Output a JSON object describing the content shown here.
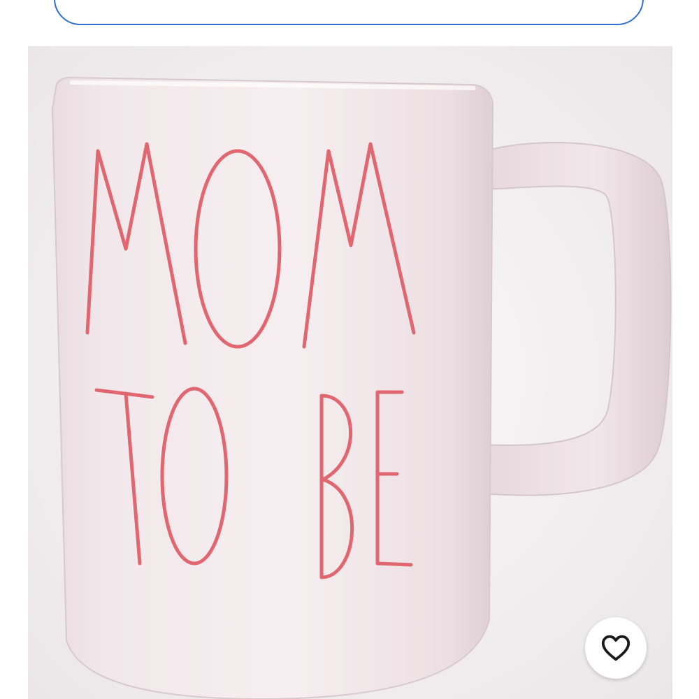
{
  "search": {
    "value": ""
  },
  "listing": {
    "photo": {
      "text_line_1": "MOM",
      "text_line_2": "TO BE"
    },
    "favorite": {
      "icon": "heart-outline-icon"
    }
  },
  "colors": {
    "field_border": "#2f6fcf",
    "mug_body": "#f3e9ec",
    "mug_lettering": "#e0666f",
    "background": "#f4f1f3"
  }
}
